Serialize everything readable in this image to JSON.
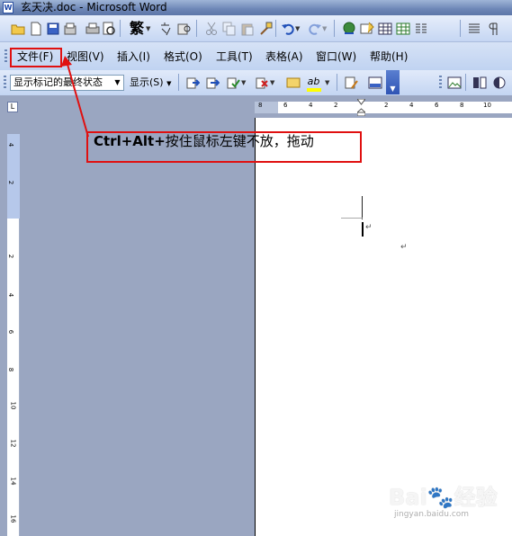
{
  "window": {
    "title": "玄天决.doc - Microsoft Word",
    "app_icon": "W"
  },
  "menubar": {
    "items": [
      {
        "label": "文件(F)"
      },
      {
        "label": "视图(V)"
      },
      {
        "label": "插入(I)"
      },
      {
        "label": "格式(O)"
      },
      {
        "label": "工具(T)"
      },
      {
        "label": "表格(A)"
      },
      {
        "label": "窗口(W)"
      },
      {
        "label": "帮助(H)"
      }
    ]
  },
  "toolbar_standard": {
    "icons": [
      "open-folder-icon",
      "new-document-icon",
      "save-icon",
      "permission-icon",
      "print-icon",
      "print-preview-icon",
      "traditional-chinese-convert-icon",
      "translate-icon",
      "research-icon",
      "cut-icon",
      "copy-icon",
      "paste-icon",
      "format-painter-icon",
      "undo-icon",
      "redo-icon",
      "hyperlink-icon",
      "tables-borders-icon",
      "insert-table-icon",
      "insert-excel-icon",
      "columns-icon",
      "show-hide-icon"
    ],
    "traditional_label": "繁"
  },
  "toolbar_reviewing": {
    "markup_select_value": "显示标记的最终状态",
    "show_label": "显示(S)",
    "icons": [
      "previous-change-icon",
      "next-change-icon",
      "accept-change-icon",
      "reject-change-icon",
      "new-comment-icon",
      "highlight-icon",
      "track-changes-icon",
      "reviewing-pane-icon"
    ],
    "highlight_label": "ab"
  },
  "ruler": {
    "corner": "L",
    "left_numbers": [
      "8",
      "6",
      "4",
      "2"
    ],
    "right_numbers": [
      "2",
      "4",
      "6",
      "8",
      "10"
    ],
    "vertical_numbers": [
      "4",
      "2",
      "2",
      "4",
      "6",
      "8",
      "10",
      "12",
      "14",
      "16"
    ]
  },
  "document": {
    "paragraph_mark": "↵"
  },
  "annotation": {
    "bold_text": "Ctrl+Alt+",
    "text": "按住鼠标左键不放，拖动"
  },
  "watermark": {
    "text": "Bai",
    "suffix": "经验",
    "url": "jingyan.baidu.com"
  },
  "colors": {
    "highlight_box": "#e01010",
    "toolbar_blue": "#c5d6f3"
  }
}
